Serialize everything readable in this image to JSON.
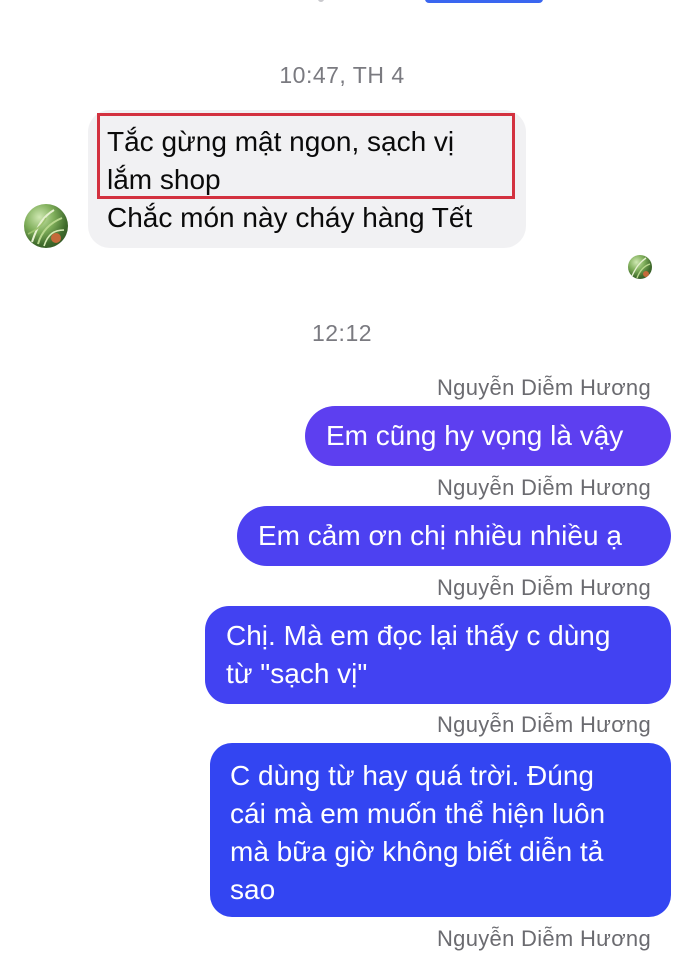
{
  "thread": {
    "timestamp_1": "10:47, TH 4",
    "incoming": {
      "lines": [
        "Tắc gừng mật ngon, sạch vị",
        "lắm shop",
        "Chắc món này cháy hàng Tết"
      ]
    },
    "timestamp_2": "12:12",
    "outgoing": [
      {
        "sender": "Nguyễn Diễm Hương",
        "lines": [
          "Em cũng hy vọng là vậy"
        ]
      },
      {
        "sender": "Nguyễn Diễm Hương",
        "lines": [
          "Em cảm ơn chị nhiều nhiều ạ"
        ]
      },
      {
        "sender": "Nguyễn Diễm Hương",
        "lines": [
          "Chị. Mà em đọc lại thấy c dùng",
          "từ \"sạch vị\""
        ]
      },
      {
        "sender": "Nguyễn Diễm Hương",
        "lines": [
          "C dùng từ hay quá trời. Đúng",
          "cái mà em muốn thể hiện luôn",
          "mà bữa giờ không biết diễn tả",
          "sao"
        ]
      }
    ],
    "trailing_sender": "Nguyễn Diễm Hương"
  },
  "colors": {
    "incoming_bubble": "#f1f1f3",
    "outgoing_gradient_top": "#6a3ff0",
    "outgoing_gradient_bottom": "#2f46f2",
    "highlight": "#d3313f",
    "meta_text": "#7a7a80"
  },
  "icons": {
    "contact_avatar": "avatar-plant-icon",
    "read_receipt": "seen-avatar-icon"
  }
}
